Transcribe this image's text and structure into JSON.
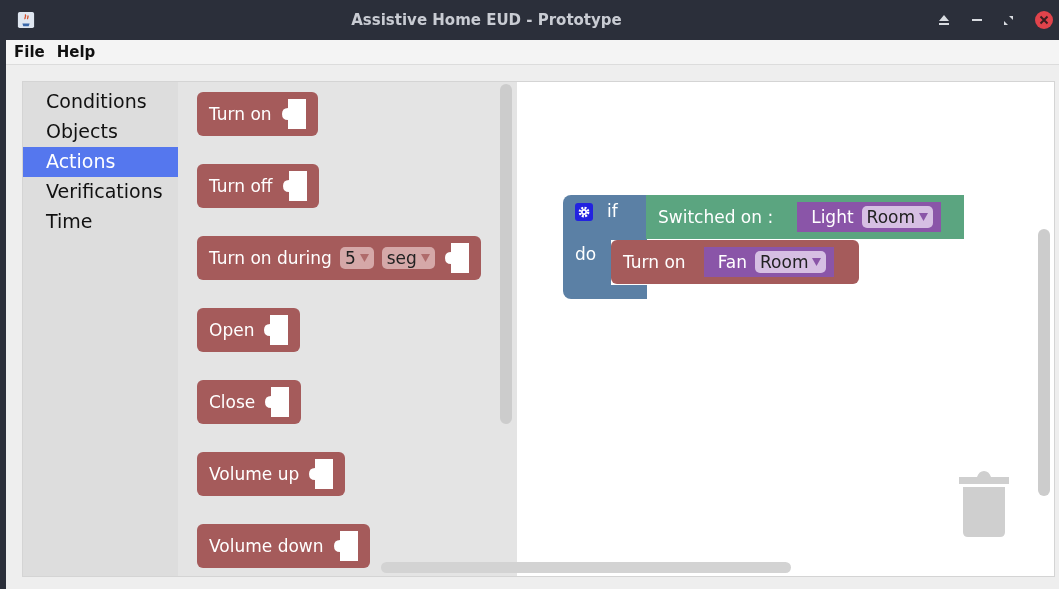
{
  "window": {
    "title": "Assistive Home EUD - Prototype"
  },
  "menu": [
    {
      "label": "File"
    },
    {
      "label": "Help"
    }
  ],
  "categories": [
    {
      "label": "Conditions",
      "selected": false
    },
    {
      "label": "Objects",
      "selected": false
    },
    {
      "label": "Actions",
      "selected": true
    },
    {
      "label": "Verifications",
      "selected": false
    },
    {
      "label": "Time",
      "selected": false
    }
  ],
  "flyout_blocks": [
    {
      "label": "Turn on"
    },
    {
      "label": "Turn off"
    },
    {
      "label": "Turn on during",
      "dropdowns": [
        "5",
        "seg"
      ]
    },
    {
      "label": "Open"
    },
    {
      "label": "Close"
    },
    {
      "label": "Volume up"
    },
    {
      "label": "Volume down"
    }
  ],
  "workspace": {
    "if_block": {
      "if_label": "if",
      "do_label": "do",
      "condition": {
        "label": "Switched on :",
        "object": {
          "label": "Light",
          "dropdown": "Room"
        }
      },
      "action": {
        "label": "Turn on",
        "object": {
          "label": "Fan",
          "dropdown": "Room"
        }
      }
    }
  }
}
